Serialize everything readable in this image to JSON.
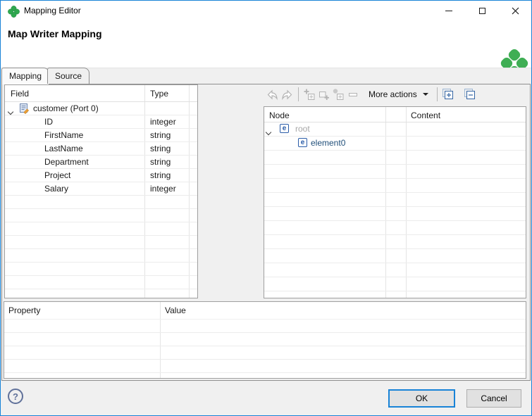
{
  "window": {
    "title": "Mapping Editor"
  },
  "header": {
    "title": "Map Writer Mapping"
  },
  "tabs": {
    "mapping": "Mapping",
    "source": "Source"
  },
  "field_table": {
    "col_field": "Field",
    "col_type": "Type",
    "root_label": "customer (Port 0)",
    "rows": [
      {
        "field": "ID",
        "type": "integer"
      },
      {
        "field": "FirstName",
        "type": "string"
      },
      {
        "field": "LastName",
        "type": "string"
      },
      {
        "field": "Department",
        "type": "string"
      },
      {
        "field": "Project",
        "type": "string"
      },
      {
        "field": "Salary",
        "type": "integer"
      }
    ]
  },
  "toolbar": {
    "more_actions_label": "More actions"
  },
  "node_table": {
    "col_node": "Node",
    "col_content": "Content",
    "root_label": "root",
    "child_label": "element0"
  },
  "property_table": {
    "col_property": "Property",
    "col_value": "Value"
  },
  "footer": {
    "help_glyph": "?",
    "ok_label": "OK",
    "cancel_label": "Cancel"
  },
  "icons": {
    "element_glyph": "e"
  },
  "colors": {
    "accent_blue": "#1883d7",
    "logo_green": "#3fae54",
    "element_blue": "#2a5ca8"
  }
}
